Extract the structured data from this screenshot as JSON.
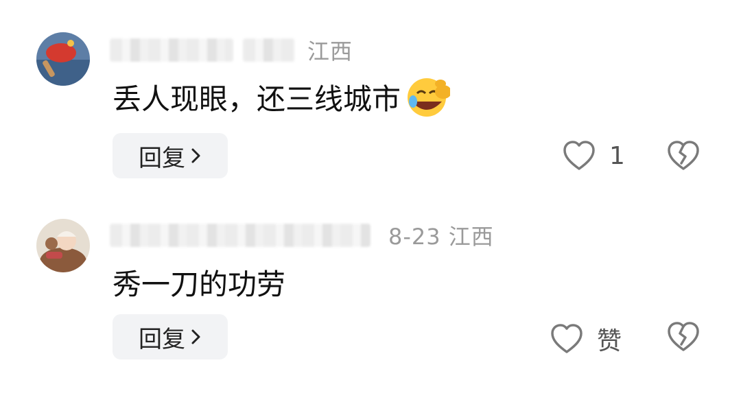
{
  "comments": [
    {
      "meta_text": "江西",
      "text": "丢人现眼，还三线城市",
      "emoji": "loudly-laughing-face",
      "reply_label": "回复",
      "like_count": "1"
    },
    {
      "meta_text": "8-23  江西",
      "text": "秀一刀的功劳",
      "reply_label": "回复",
      "like_count": "赞"
    }
  ],
  "colors": {
    "meta_gray": "#9a9a9a",
    "text": "#111111",
    "reply_bg": "#f2f3f5",
    "icon_stroke": "#7a7a7a"
  }
}
